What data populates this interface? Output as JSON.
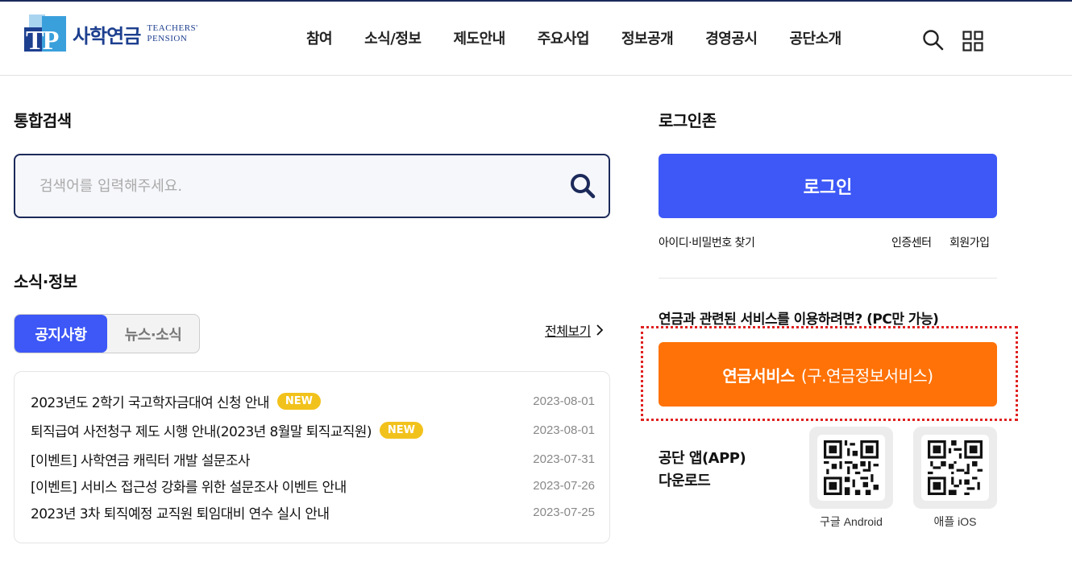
{
  "header": {
    "logo_ko": "사학연금",
    "logo_en_line1": "TEACHERS'",
    "logo_en_line2": "PENSION",
    "logo_mark": "TP",
    "nav": [
      "참여",
      "소식/정보",
      "제도안내",
      "주요사업",
      "정보공개",
      "경영공시",
      "공단소개"
    ],
    "icons": [
      "search-icon",
      "grid-menu-icon"
    ]
  },
  "search": {
    "title": "통합검색",
    "placeholder": "검색어를 입력해주세요."
  },
  "news": {
    "title": "소식·정보",
    "tabs": [
      "공지사항",
      "뉴스·소식"
    ],
    "active_tab": "공지사항",
    "view_all": "전체보기",
    "items": [
      {
        "title": "2023년도 2학기 국고학자금대여 신청 안내",
        "badge": "NEW",
        "date": "2023-08-01"
      },
      {
        "title": "퇴직급여 사전청구 제도 시행 안내(2023년 8월말 퇴직교직원)",
        "badge": "NEW",
        "date": "2023-08-01"
      },
      {
        "title": "[이벤트] 사학연금 캐릭터 개발 설문조사",
        "badge": "",
        "date": "2023-07-31"
      },
      {
        "title": "[이벤트] 서비스 접근성 강화를 위한 설문조사 이벤트 안내",
        "badge": "",
        "date": "2023-07-26"
      },
      {
        "title": "2023년 3차 퇴직예정 교직원 퇴임대비 연수 실시 안내",
        "badge": "",
        "date": "2023-07-25"
      }
    ]
  },
  "login": {
    "title": "로그인존",
    "button": "로그인",
    "find_id_pw": "아이디·비밀번호 찾기",
    "cert_center": "인증센터",
    "signup": "회원가입"
  },
  "pension": {
    "question": "연금과 관련된 서비스를 이용하려면? (PC만 가능)",
    "button_main": "연금서비스",
    "button_sub": "(구.연금정보서비스)"
  },
  "app": {
    "label_line1": "공단 앱(APP)",
    "label_line2": "다운로드",
    "android": "구글 Android",
    "ios": "애플 iOS"
  },
  "colors": {
    "primary": "#3d58f6",
    "orange": "#ff7207",
    "navy": "#1c2a5a",
    "badge": "#f2c21c",
    "highlight": "#e02020"
  }
}
